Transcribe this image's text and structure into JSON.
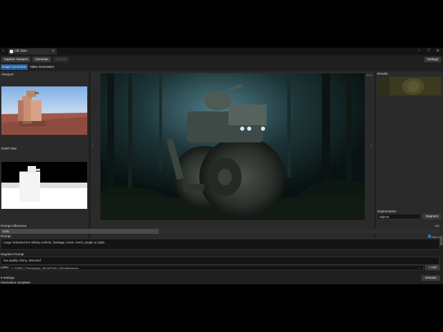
{
  "window": {
    "tab_title": "UE Gen",
    "controls": {
      "minimize": "–",
      "maximize": "□",
      "close": "✕"
    }
  },
  "toolbar": {
    "capture_viewport": "Capture Viewport",
    "generate": "Generate",
    "cancel": "Cancel",
    "settings": "Settings"
  },
  "mode_tabs": [
    "Image Generation",
    "Video Generation"
  ],
  "left_panel": {
    "viewport_label": "Viewport",
    "depth_map_label": "Depth Map"
  },
  "preview": {
    "counter": "1 / 1",
    "prev": "‹",
    "next": "›"
  },
  "results": {
    "label": "Results"
  },
  "segmentation": {
    "label": "Segmentation",
    "input_value": "objects",
    "button": "Segment"
  },
  "prompt_adherence": {
    "label": "Prompt Adherence",
    "value": "0.95",
    "max_label": "285",
    "fill_fraction": 0.36
  },
  "prompt": {
    "label": "Prompt",
    "checkbox_label": "Sync to",
    "checked": true,
    "text": "Large industrial tire military vehicle, fuselage, turret, mech, jungle at night."
  },
  "negative_prompt": {
    "label": "Negative Prompt",
    "text": "low quality, blurry, distorted"
  },
  "lora": {
    "label": "LoRA",
    "value": "Z-TURBO_Photography_35mmPhoto_V58.safetensors",
    "add_button": "+ Add"
  },
  "settings_section": {
    "label": "▾ Settings",
    "defaults_button": "Defaults"
  },
  "status": {
    "text": "Generation complete!"
  },
  "colors": {
    "accent_blue": "#1f5fa8",
    "panel_bg": "#2a2a2a",
    "app_bg": "#1f1f1f",
    "viewport_sky": "#8fb9e8",
    "viewport_ground": "#a0584a",
    "depth_fg": "#ffffff"
  }
}
